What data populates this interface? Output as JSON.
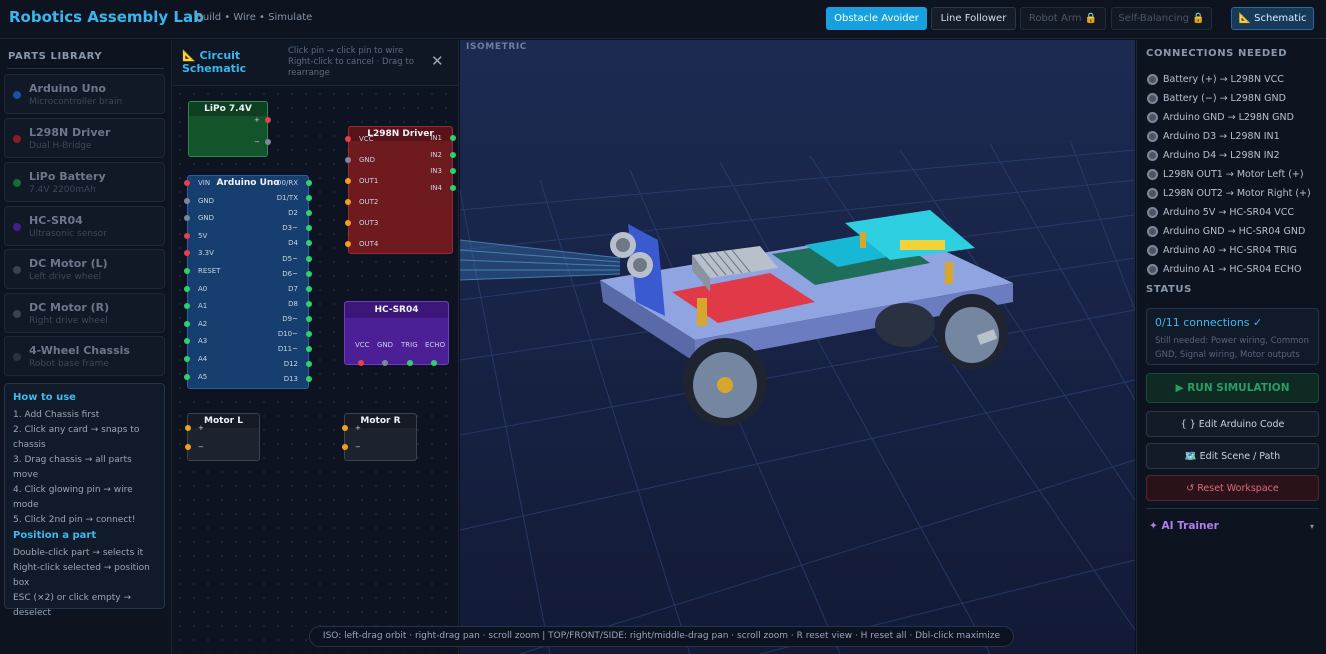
{
  "app": {
    "title": "Robotics Assembly Lab",
    "subtitle": "Build • Wire • Simulate"
  },
  "modes": [
    {
      "label": "Obstacle Avoider",
      "state": "active"
    },
    {
      "label": "Line Follower",
      "state": "normal"
    },
    {
      "label": "Robot Arm 🔒",
      "state": "locked"
    },
    {
      "label": "Self-Balancing 🔒",
      "state": "locked"
    },
    {
      "label": "📐 Schematic",
      "state": "toggle"
    }
  ],
  "parts_library": {
    "heading": "PARTS LIBRARY",
    "items": [
      {
        "name": "Arduino Uno",
        "desc": "Microcontroller brain",
        "color": "#1f4fa0"
      },
      {
        "name": "L298N Driver",
        "desc": "Dual H-Bridge",
        "color": "#8a1c26"
      },
      {
        "name": "LiPo Battery",
        "desc": "7.4V 2200mAh",
        "color": "#176b35"
      },
      {
        "name": "HC-SR04",
        "desc": "Ultrasonic sensor",
        "color": "#4a1c8a"
      },
      {
        "name": "DC Motor (L)",
        "desc": "Left drive wheel",
        "color": "#3b4150"
      },
      {
        "name": "DC Motor (R)",
        "desc": "Right drive wheel",
        "color": "#3b4150"
      },
      {
        "name": "4-Wheel Chassis",
        "desc": "Robot base frame",
        "color": "#2c313c"
      }
    ]
  },
  "howto": {
    "title": "How to use",
    "steps": [
      "1. Add Chassis first",
      "2. Click any card → snaps to",
      "chassis",
      "3. Drag chassis → all parts move",
      "4. Click glowing pin → wire",
      "mode",
      "5. Click 2nd pin → connect!"
    ],
    "position_title": "Position a part",
    "position_lines": [
      "Double-click part → selects it",
      "Right-click selected → position",
      "box",
      "ESC (×2) or click empty →",
      "deselect"
    ]
  },
  "schematic": {
    "title": "📐 Circuit Schematic",
    "hint": "Click pin → click pin to wire  Right-click to cancel · Drag to rearrange",
    "close": "✕",
    "components": {
      "lipo": {
        "title": "LiPo 7.4V",
        "pins": [
          "+",
          "−"
        ]
      },
      "arduino": {
        "title": "Arduino Uno",
        "left_pins": [
          "VIN",
          "GND",
          "GND",
          "5V",
          "3.3V",
          "RESET",
          "A0",
          "A1",
          "A2",
          "A3",
          "A4",
          "A5"
        ],
        "right_pins": [
          "D0/RX",
          "D1/TX",
          "D2",
          "D3~",
          "D4",
          "D5~",
          "D6~",
          "D7",
          "D8",
          "D9~",
          "D10~",
          "D11~",
          "D12",
          "D13"
        ]
      },
      "l298n": {
        "title": "L298N Driver",
        "left_pins": [
          "VCC",
          "GND",
          "OUT1",
          "OUT2",
          "OUT3",
          "OUT4"
        ],
        "right_pins": [
          "IN1",
          "IN2",
          "IN3",
          "IN4"
        ]
      },
      "hcsr04": {
        "title": "HC-SR04",
        "pins": [
          "VCC",
          "GND",
          "TRIG",
          "ECHO"
        ]
      },
      "motor_l": {
        "title": "Motor L",
        "pins": [
          "+",
          "−"
        ]
      },
      "motor_r": {
        "title": "Motor R",
        "pins": [
          "+",
          "−"
        ]
      }
    }
  },
  "view3d": {
    "label": "ISOMETRIC",
    "help": "ISO: left-drag orbit · right-drag pan · scroll zoom  |  TOP/FRONT/SIDE: right/middle-drag pan · scroll zoom · R reset view · H reset all · Dbl-click maximize"
  },
  "connections": {
    "heading": "CONNECTIONS NEEDED",
    "items": [
      "Battery (+) → L298N VCC",
      "Battery (−) → L298N GND",
      "Arduino GND → L298N GND",
      "Arduino D3 → L298N IN1",
      "Arduino D4 → L298N IN2",
      "L298N OUT1 → Motor Left (+)",
      "L298N OUT2 → Motor Right (+)",
      "Arduino 5V → HC-SR04 VCC",
      "Arduino GND → HC-SR04 GND",
      "Arduino A0 → HC-SR04 TRIG",
      "Arduino A1 → HC-SR04 ECHO"
    ]
  },
  "status": {
    "heading": "STATUS",
    "main": "0/11 connections ✓",
    "sub": "Still needed: Power wiring, Common GND, Signal wiring, Motor outputs"
  },
  "actions": {
    "run": "▶ RUN SIMULATION",
    "edit_code": "{ } Edit Arduino Code",
    "edit_scene": "🗺️ Edit Scene / Path",
    "reset": "↺ Reset Workspace"
  },
  "ai_trainer": {
    "label": "✦ AI Trainer",
    "caret": "▾"
  },
  "colors": {
    "accent": "#16a0e0",
    "pin_red": "#e8404a",
    "pin_green": "#2bd46b",
    "pin_orange": "#f0a020",
    "pin_gray": "#7d8899"
  }
}
